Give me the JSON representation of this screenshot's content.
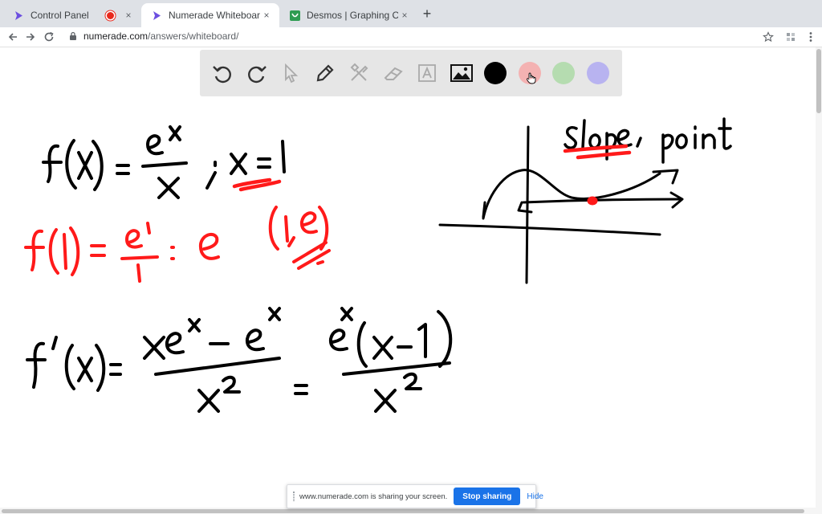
{
  "tabs": [
    {
      "title": "Control Panel",
      "recording": true
    },
    {
      "title": "Numerade Whiteboard",
      "active": true
    },
    {
      "title": "Desmos | Graphing Calculator"
    }
  ],
  "icons": {
    "close": "×",
    "new_tab": "+",
    "back": "←",
    "forward": "→",
    "reload": "⟳"
  },
  "address": {
    "host": "numerade.com",
    "path": "/answers/whiteboard/"
  },
  "toolbar_icons": [
    "undo-icon",
    "redo-icon",
    "select-icon",
    "pen-icon",
    "tools-icon",
    "eraser-icon",
    "text-icon",
    "image-icon"
  ],
  "palette_colors": [
    "#000000",
    "#f4b2b2",
    "#b5dcb0",
    "#b8b3f0"
  ],
  "colors": {
    "ink_black": "#000000",
    "ink_red": "#ff1a1a",
    "share_button": "#1a73e8"
  },
  "share": {
    "message": "www.numerade.com is sharing your screen.",
    "stop_label": "Stop sharing",
    "hide_label": "Hide"
  },
  "whiteboard_lines": [
    "f(x) = e^x / x ; x = 1",
    "f(1) = e^1 / 1 = e",
    "(1, e)",
    "slope, point",
    "f'(x) = (xe^x − e^x) / x^2 = e^x(x−1) / x^2"
  ]
}
